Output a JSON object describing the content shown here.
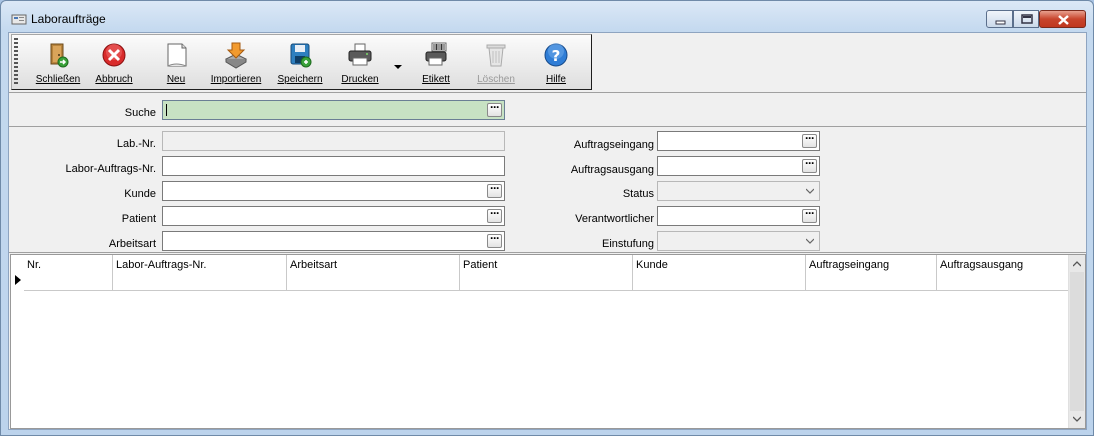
{
  "window": {
    "title": "Laboraufträge"
  },
  "toolbar": {
    "buttons": [
      {
        "label": "Schließen",
        "icon": "exit-door-icon",
        "enabled": true
      },
      {
        "label": "Abbruch",
        "icon": "cancel-icon",
        "enabled": true
      },
      {
        "label": "Neu",
        "icon": "new-document-icon",
        "enabled": true
      },
      {
        "label": "Importieren",
        "icon": "import-icon",
        "enabled": true
      },
      {
        "label": "Speichern",
        "icon": "save-icon",
        "enabled": true
      },
      {
        "label": "Drucken",
        "icon": "printer-icon",
        "enabled": true
      },
      {
        "label": "Etikett",
        "icon": "label-printer-icon",
        "enabled": true
      },
      {
        "label": "Löschen",
        "icon": "trash-icon",
        "enabled": false
      },
      {
        "label": "Hilfe",
        "icon": "help-icon",
        "enabled": true
      }
    ]
  },
  "search": {
    "label": "Suche",
    "value": ""
  },
  "form": {
    "lab_nr": {
      "label": "Lab.-Nr.",
      "value": ""
    },
    "labor_auftrags_nr": {
      "label": "Labor-Auftrags-Nr.",
      "value": ""
    },
    "kunde": {
      "label": "Kunde",
      "value": ""
    },
    "patient": {
      "label": "Patient",
      "value": ""
    },
    "arbeitsart": {
      "label": "Arbeitsart",
      "value": ""
    },
    "auftragseingang": {
      "label": "Auftragseingang",
      "value": ""
    },
    "auftragsausgang": {
      "label": "Auftragsausgang",
      "value": ""
    },
    "status": {
      "label": "Status",
      "value": ""
    },
    "verantwortlicher": {
      "label": "Verantwortlicher",
      "value": ""
    },
    "einstufung": {
      "label": "Einstufung",
      "value": ""
    }
  },
  "grid": {
    "columns": [
      "Nr.",
      "Labor-Auftrags-Nr.",
      "Arbeitsart",
      "Patient",
      "Kunde",
      "Auftragseingang",
      "Auftragsausgang"
    ],
    "rows": []
  },
  "colors": {
    "search_bg": "#c7e2c3",
    "title_bar": "#c4d9ef",
    "close_button": "#c8452d"
  }
}
